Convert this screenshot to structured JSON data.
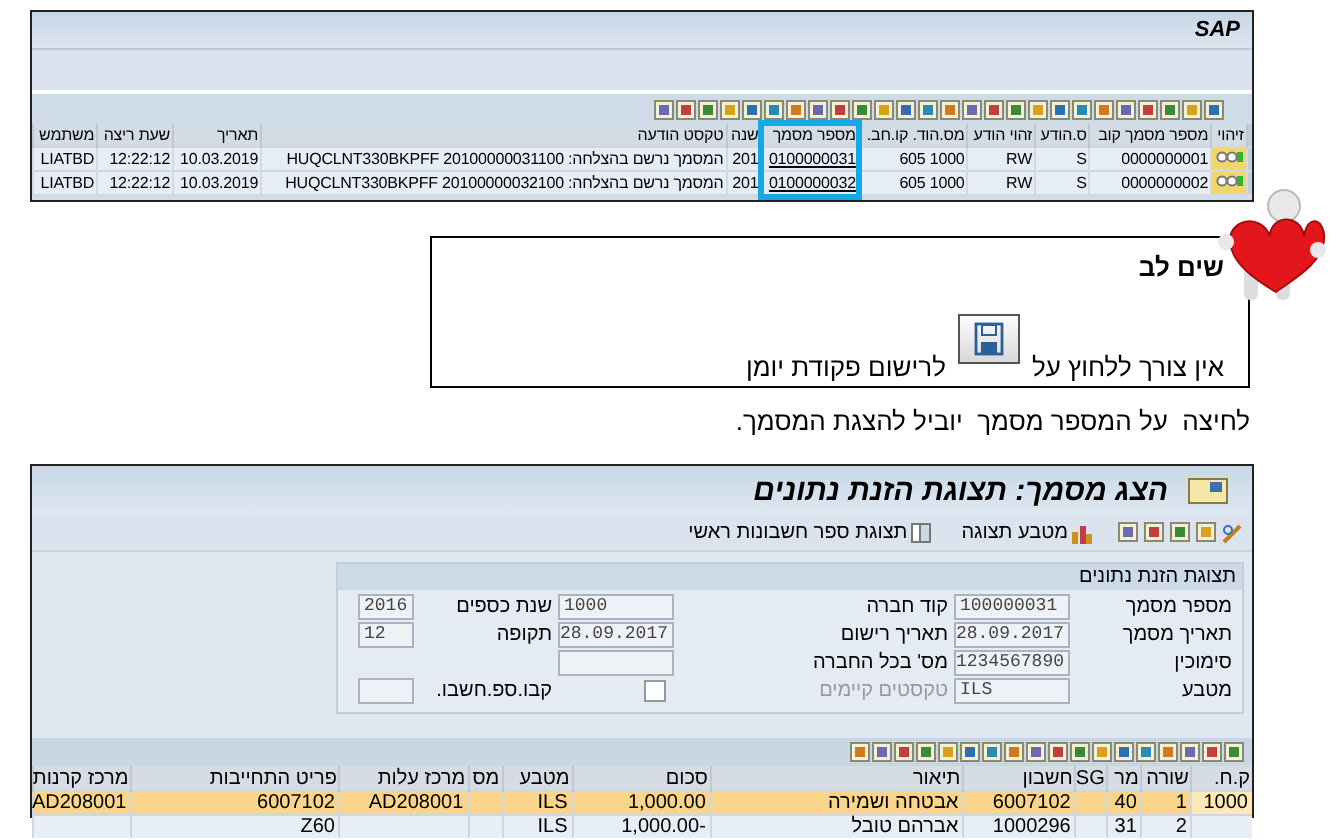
{
  "log_window": {
    "brand": "SAP",
    "columns": [
      {
        "label": "זיהוי",
        "kind": "status",
        "highlight": false
      },
      {
        "label": "מספר מסמך קוב",
        "kind": "text",
        "highlight": false
      },
      {
        "label": "ס.הודע",
        "kind": "text",
        "highlight": false
      },
      {
        "label": "זהוי הודע",
        "kind": "text",
        "highlight": false
      },
      {
        "label": "מס.הוד. קו.חב.",
        "kind": "text",
        "highlight": false
      },
      {
        "label": "מספר מסמך",
        "kind": "link",
        "highlight": true
      },
      {
        "label": "שנה",
        "kind": "text",
        "highlight": false
      },
      {
        "label": "טקסט הודעה",
        "kind": "text",
        "highlight": false
      },
      {
        "label": "תאריך",
        "kind": "text",
        "highlight": false
      },
      {
        "label": "שעת ריצה",
        "kind": "text",
        "highlight": false
      },
      {
        "label": "משתמש",
        "kind": "text",
        "highlight": false
      }
    ],
    "rows": [
      {
        "cells": [
          null,
          "0000000001",
          "S",
          "RW",
          "1000 605",
          "0100000031",
          "201",
          "המסמך נרשם בהצלחה: HUQCLNT330BKPFF 20100000031100",
          "10.03.2019",
          "12:22:12",
          "LIATBD"
        ]
      },
      {
        "cells": [
          null,
          "0000000002",
          "S",
          "RW",
          "1000 605",
          "0100000032",
          "201",
          "המסמך נרשם בהצלחה: HUQCLNT330BKPFF 20100000032100",
          "10.03.2019",
          "12:22:12",
          "LIATBD"
        ]
      }
    ]
  },
  "note": {
    "title": "שים לב",
    "text_before": "אין צורך ללחוץ על",
    "text_after": "לרישום פקודת יומן"
  },
  "instruction": "לחיצה  על המספר מסמך  יוביל להצגת המסמך.",
  "document_window": {
    "title": "הצג מסמך: תצוגת הזנת נתונים",
    "toolbar": [
      {
        "label": "מטבע תצוגה"
      },
      {
        "label": "תצוגת ספר חשבונות ראשי"
      }
    ],
    "group_title": "תצוגת הזנת נתונים",
    "fields": [
      [
        {
          "label": "מספר מסמך",
          "kind": "field",
          "value": "100000031"
        },
        {
          "label": "קוד חברה",
          "kind": "field",
          "value": "1000"
        },
        {
          "label": "שנת כספים",
          "kind": "field",
          "value": "2016"
        }
      ],
      [
        {
          "label": "תאריך מסמך",
          "kind": "field",
          "value": "28.09.2017"
        },
        {
          "label": "תאריך רישום",
          "kind": "field",
          "value": "28.09.2017"
        },
        {
          "label": "תקופה",
          "kind": "field",
          "value": "12"
        }
      ],
      [
        {
          "label": "סימוכין",
          "kind": "field",
          "value": "1234567890"
        },
        {
          "label": "מס' בכל החברה",
          "kind": "field"
        }
      ],
      [
        {
          "label": "מטבע",
          "kind": "field",
          "value": "ILS"
        },
        {
          "label": "טקסטים קיימים",
          "kind": "checkbox",
          "checked": false
        },
        {
          "label": "קבו.ספ.חשבו.",
          "kind": "field"
        }
      ]
    ],
    "columns": [
      "ק.ח.",
      "שורה",
      "מר",
      "SG",
      "חשבון",
      "תיאור",
      "סכום",
      "מטבע",
      "מס",
      "מרכז עלות",
      "פריט התחייבות",
      "מרכז קרנות"
    ],
    "rows": [
      {
        "selected": true,
        "cells": [
          "1000",
          "1",
          "40",
          null,
          "6007102",
          "אבטחה ושמירה",
          "1,000.00",
          "ILS",
          null,
          "AD208001",
          "6007102",
          "AD208001"
        ]
      },
      {
        "selected": false,
        "cells": [
          null,
          "2",
          "31",
          null,
          "1000296",
          "אברהם טובל",
          "-1,000.00",
          "ILS",
          null,
          null,
          "Z60",
          null
        ]
      }
    ]
  }
}
